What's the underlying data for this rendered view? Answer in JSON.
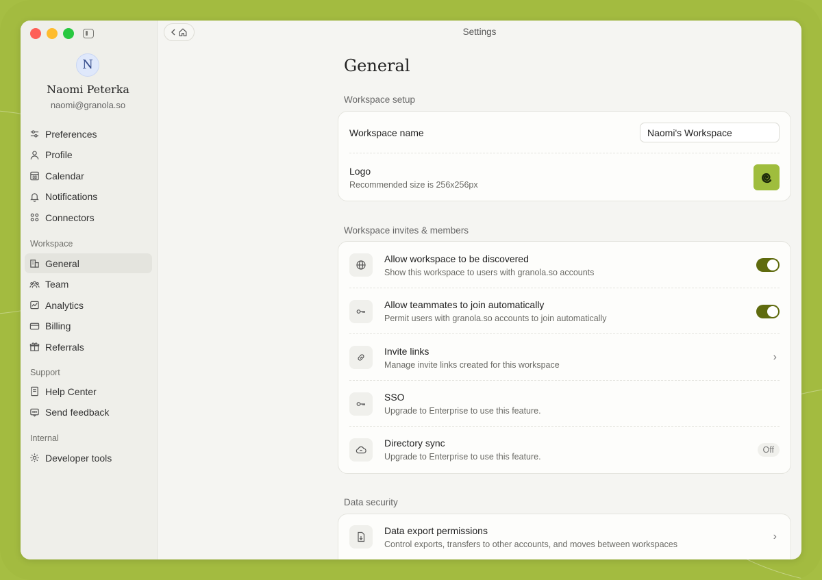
{
  "window": {
    "title": "Settings"
  },
  "user": {
    "initial": "N",
    "name": "Naomi Peterka",
    "email": "naomi@granola.so"
  },
  "sidebar": {
    "items": [
      {
        "label": "Preferences",
        "icon": "sliders-icon"
      },
      {
        "label": "Profile",
        "icon": "person-icon"
      },
      {
        "label": "Calendar",
        "icon": "calendar-icon"
      },
      {
        "label": "Notifications",
        "icon": "bell-icon"
      },
      {
        "label": "Connectors",
        "icon": "connectors-icon"
      }
    ],
    "workspace_heading": "Workspace",
    "workspace_items": [
      {
        "label": "General",
        "icon": "building-icon",
        "active": true
      },
      {
        "label": "Team",
        "icon": "team-icon"
      },
      {
        "label": "Analytics",
        "icon": "analytics-icon"
      },
      {
        "label": "Billing",
        "icon": "card-icon"
      },
      {
        "label": "Referrals",
        "icon": "gift-icon"
      }
    ],
    "support_heading": "Support",
    "support_items": [
      {
        "label": "Help Center",
        "icon": "book-icon"
      },
      {
        "label": "Send feedback",
        "icon": "feedback-icon"
      }
    ],
    "internal_heading": "Internal",
    "internal_items": [
      {
        "label": "Developer tools",
        "icon": "gear-icon"
      }
    ]
  },
  "main": {
    "title": "General",
    "setup": {
      "label": "Workspace setup",
      "name_label": "Workspace name",
      "name_value": "Naomi's Workspace",
      "logo_label": "Logo",
      "logo_sub": "Recommended size is 256x256px"
    },
    "invites": {
      "label": "Workspace invites & members",
      "rows": [
        {
          "title": "Allow workspace to be discovered",
          "sub": "Show this workspace to users with granola.so accounts",
          "icon": "globe-icon",
          "toggle": true
        },
        {
          "title": "Allow teammates to join automatically",
          "sub": "Permit users with granola.so accounts to join automatically",
          "icon": "key-icon",
          "toggle": true
        },
        {
          "title": "Invite links",
          "sub": "Manage invite links created for this workspace",
          "icon": "link-icon",
          "chevron": "›"
        },
        {
          "title": "SSO",
          "sub": "Upgrade to Enterprise to use this feature.",
          "icon": "key-icon"
        },
        {
          "title": "Directory sync",
          "sub": "Upgrade to Enterprise to use this feature.",
          "icon": "cloud-sync-icon",
          "badge": "Off"
        }
      ]
    },
    "security": {
      "label": "Data security",
      "rows": [
        {
          "title": "Data export permissions",
          "sub": "Control exports, transfers to other accounts, and moves between workspaces",
          "icon": "file-export-icon",
          "chevron": "›"
        }
      ]
    }
  },
  "colors": {
    "toggle_on": "#5f6b0e",
    "brand": "#9fbd3d",
    "background": "#a3bb40"
  }
}
